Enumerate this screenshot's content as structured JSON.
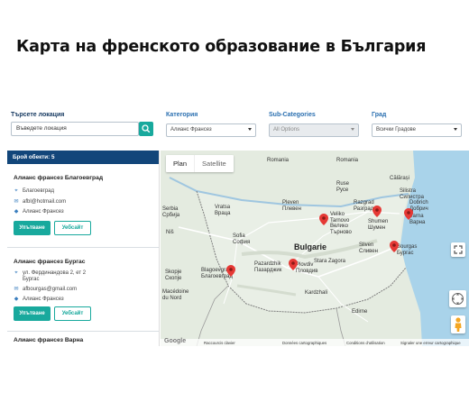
{
  "page": {
    "title": "Карта на френското образование в България"
  },
  "filters": {
    "search_label": "Търсете локация",
    "search_placeholder": "Въведете локация",
    "category_label": "Категория",
    "category_value": "Алианс Франсез",
    "subcategory_label": "Sub-Categories",
    "subcategory_value": "All Options",
    "city_label": "Град",
    "city_value": "Всички Градове",
    "accent_color": "#18a99d",
    "header_color": "#12467a"
  },
  "results": {
    "count_label": "Брой обекти: 5",
    "items": [
      {
        "name": "Алианс франсез Благоевград",
        "address": "Благоевград",
        "email": "afbl@hotmail.com",
        "category": "Алианс Франсез",
        "directions_label": "Упътване",
        "website_label": "Уебсайт"
      },
      {
        "name": "Алианс франсез Бургас",
        "address_line1": "ул. Фердинандова 2, ет 2",
        "address_line2": "Бургас",
        "email": "afbourgas@gmail.com",
        "category": "Алианс Франсез",
        "directions_label": "Упътване",
        "website_label": "Уебсайт"
      },
      {
        "name": "Алианс франсез Варна"
      }
    ]
  },
  "map": {
    "tab_plan": "Plan",
    "tab_satellite": "Satellite",
    "labels": {
      "romania1": "Romania",
      "romania2": "Romania",
      "calarasi": "Călărași",
      "ruse": "Ruse\nРусе",
      "silistra": "Silistra\nСилистра",
      "dobrich": "Dobrich\nДобрич",
      "varna": "Varna\nВарна",
      "shumen": "Shumen\nШумен",
      "razgrad": "Razgrad\nРазград",
      "vratsa": "Vratsa\nВраца",
      "pleven": "Pleven\nПлевен",
      "veliko_tarnovo": "Veliko\nTarnovo\nВелико\nТърново",
      "serbia": "Serbia\nСрбија",
      "nis": "Niš",
      "sofia": "Sofia\nСофия",
      "bulgaria": "Bulgarie",
      "sliven": "Sliven\nСливен",
      "burgas": "Bourgas\nБургас",
      "stara_zagora": "Stara Zagora",
      "pazardzhik": "Pazardzhik\nПазарджик",
      "plovdiv": "Plovdiv\nПловдив",
      "blagoevgrad": "Blagoevgrad\nБлагоевград",
      "skopje": "Skopje\nСкопје",
      "macedonia": "Macédoine\ndu Nord",
      "kardzhali": "Kardzhali",
      "edirne": "Edirne"
    },
    "footer": {
      "shortcuts": "Raccourcis clavier",
      "map_data": "Données cartographiques",
      "terms": "Conditions d'utilisation",
      "report": "Signaler une erreur cartographique"
    },
    "logo_text": "Google",
    "marker_color": "#e53935"
  }
}
